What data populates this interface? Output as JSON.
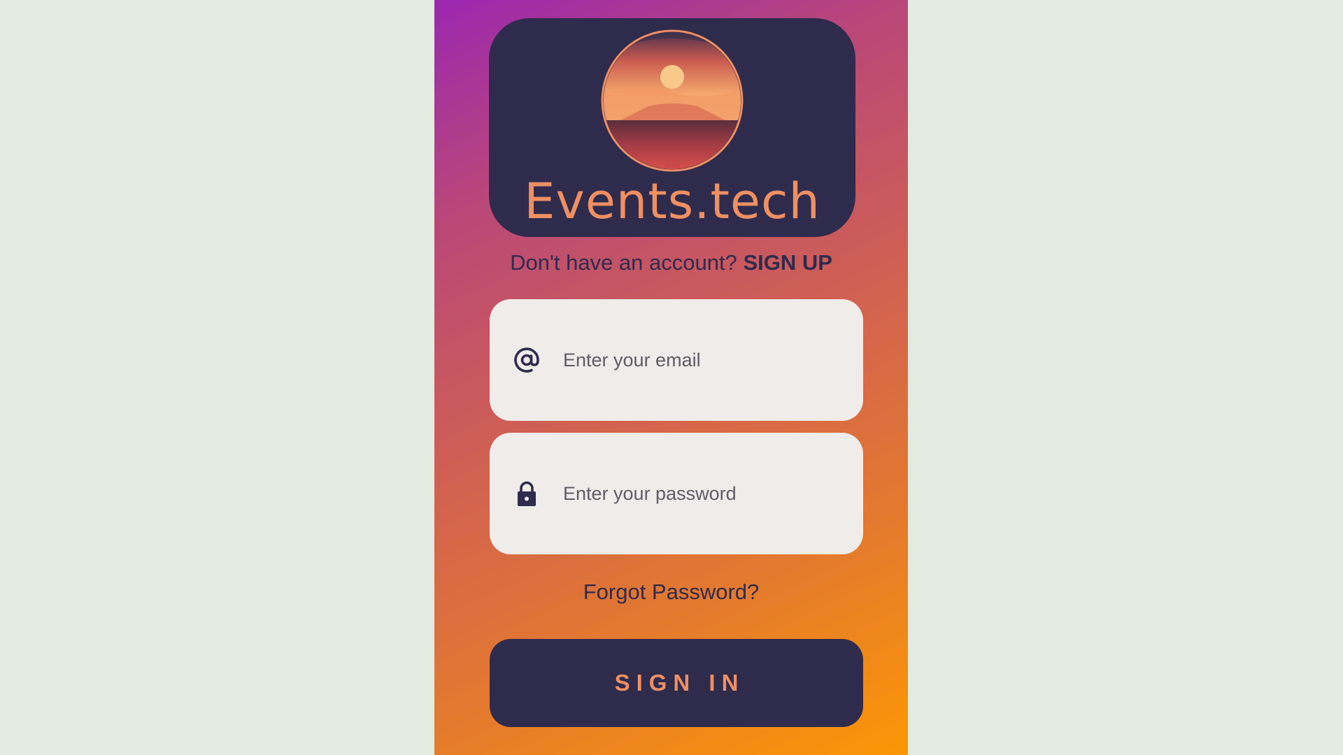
{
  "brand": {
    "name": "Events.tech",
    "logo_icon": "sunset-emblem-icon"
  },
  "signup": {
    "prompt": "Don't have an account? ",
    "link_label": "SIGN UP"
  },
  "form": {
    "email": {
      "icon": "at-sign-icon",
      "placeholder": "Enter your email",
      "value": ""
    },
    "password": {
      "icon": "lock-icon",
      "placeholder": "Enter your password",
      "value": ""
    },
    "forgot_label": "Forgot Password?",
    "submit_label": "SIGN IN"
  },
  "colors": {
    "page_background": "#e2ebe0",
    "gradient_start": "#9b27b0",
    "gradient_end": "#fb9705",
    "navy": "#2f2b4d",
    "accent": "#ef8f62",
    "field_background": "#efecea"
  }
}
